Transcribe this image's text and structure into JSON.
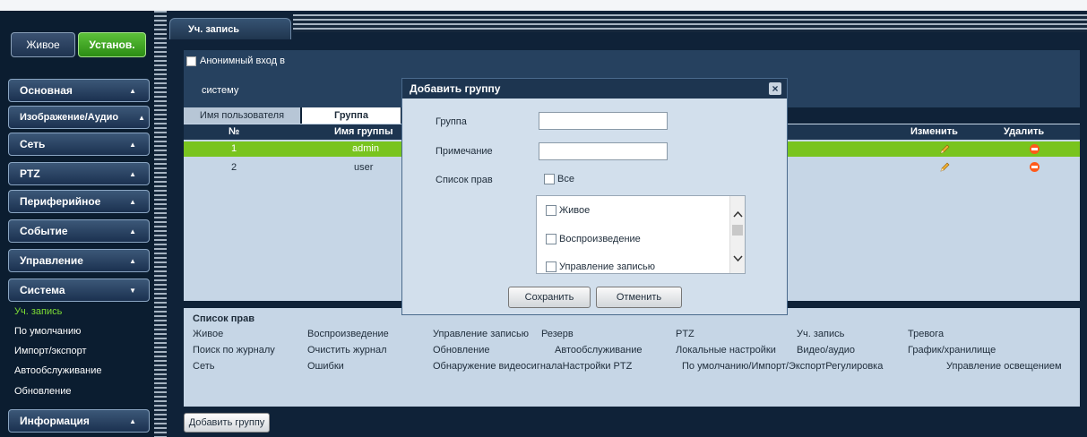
{
  "topbar": {
    "live_label": "Живое",
    "setup_label": "Установ."
  },
  "sidebar": {
    "items": [
      {
        "label": "Основная",
        "arrow": "▲"
      },
      {
        "label": "Изображение/Аудио",
        "arrow": "▲"
      },
      {
        "label": "Сеть",
        "arrow": "▲"
      },
      {
        "label": "PTZ",
        "arrow": "▲"
      },
      {
        "label": "Периферийное",
        "arrow": "▲"
      },
      {
        "label": "Событие",
        "arrow": "▲"
      },
      {
        "label": "Управление",
        "arrow": "▲"
      },
      {
        "label": "Система",
        "arrow": "▼"
      },
      {
        "label": "Информация",
        "arrow": "▲"
      }
    ],
    "submenu": [
      "Уч. запись",
      "По умолчанию",
      "Импорт/экспорт",
      "Автообслуживание",
      "Обновление"
    ]
  },
  "page": {
    "tab_title": "Уч. запись",
    "anon_line1": "Анонимный вход в",
    "anon_line2": "систему"
  },
  "tabs": {
    "user": "Имя пользователя",
    "group": "Группа"
  },
  "table": {
    "headers": {
      "num": "№",
      "name": "Имя группы",
      "edit": "Изменить",
      "delete": "Удалить"
    },
    "rows": [
      {
        "num": "1",
        "name": "admin"
      },
      {
        "num": "2",
        "name": "user"
      }
    ]
  },
  "rights": {
    "title": "Список прав",
    "row1": [
      "Живое",
      "Воспроизведение",
      "Управление записью",
      "Резерв",
      "PTZ",
      "Уч. запись",
      "Тревога"
    ],
    "row2": [
      "Поиск по журналу",
      "Очистить журнал",
      "Обновление",
      "Автообслуживание",
      "Локальные настройки",
      "Видео/аудио",
      "График/хранилище"
    ],
    "row3": [
      "Сеть",
      "Ошибки",
      "Обнаружение видеосигналаНастройки PTZ",
      "По умолчанию/Импорт/ЭкспортРегулировка",
      "Управление освещением"
    ]
  },
  "add_group_label": "Добавить группу",
  "dialog": {
    "title": "Добавить группу",
    "close": "×",
    "group_label": "Группа",
    "note_label": "Примечание",
    "rights_label": "Список прав",
    "all_label": "Все",
    "list": [
      "Живое",
      "Воспроизведение",
      "Управление записью"
    ],
    "save": "Сохранить",
    "cancel": "Отменить"
  }
}
